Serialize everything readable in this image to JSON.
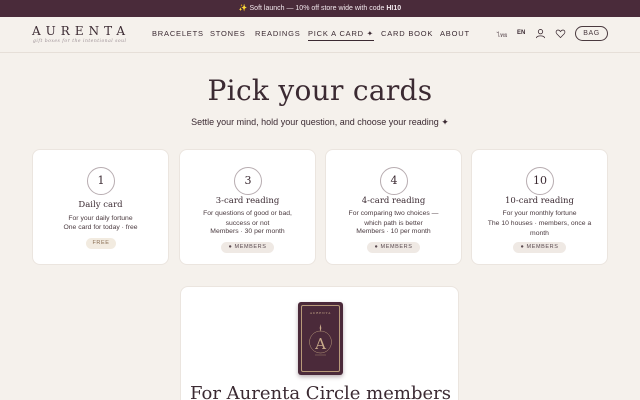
{
  "announcement": {
    "prefix": "✨ Soft launch — 10% off store wide with code ",
    "code": "HI10"
  },
  "header": {
    "logo": "AURENTA",
    "tagline": "gift boxes for the intentional soul",
    "nav": [
      "BRACELETS",
      "STONES",
      "READINGS",
      "PICK A CARD ✦",
      "CARD BOOK",
      "ABOUT"
    ],
    "active_nav": "PICK A CARD ✦",
    "lang_th": "ไทย",
    "lang_en": "EN",
    "bag": "BAG"
  },
  "hero": {
    "title": "Pick your cards",
    "subtitle": "Settle your mind, hold your question, and choose your reading ✦"
  },
  "readings": [
    {
      "number": "1",
      "title": "Daily card",
      "desc": "For your daily fortune",
      "meta": "One card for today · free",
      "badge": "FREE"
    },
    {
      "number": "3",
      "title": "3-card reading",
      "desc": "For questions of good or bad, success or not",
      "meta": "Members · 30 per month",
      "badge": "● MEMBERS"
    },
    {
      "number": "4",
      "title": "4-card reading",
      "desc": "For comparing two choices — which path is better",
      "meta": "Members · 10 per month",
      "badge": "● MEMBERS"
    },
    {
      "number": "10",
      "title": "10-card reading",
      "desc": "For your monthly fortune",
      "meta": "The 10 houses · members, once a month",
      "badge": "● MEMBERS"
    }
  ],
  "circle": {
    "card_brand": "AURENTA",
    "card_letter": "A",
    "title": "For Aurenta Circle members"
  },
  "colors": {
    "plum": "#4a2b3a",
    "background": "#f5f1ec",
    "gold": "#c9ab8b"
  },
  "icons": [
    "sparkle-icon",
    "user-icon",
    "heart-icon"
  ]
}
